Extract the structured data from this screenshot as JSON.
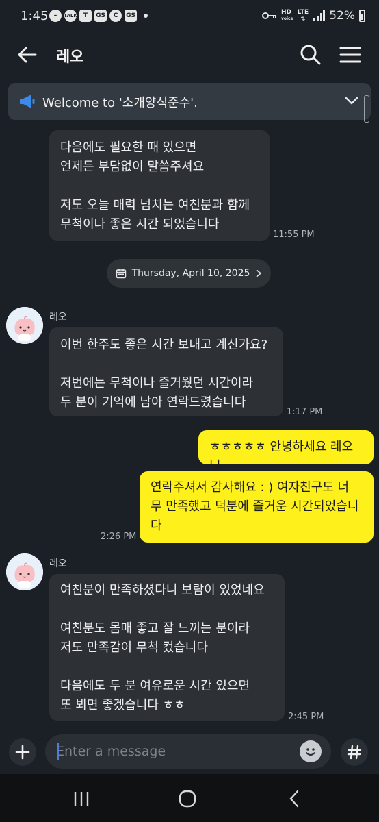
{
  "status_bar": {
    "time": "1:45",
    "icons": [
      "minus-circle-icon",
      "talk-icon",
      "teams-icon",
      "gs-icon",
      "c-icon",
      "gs-icon",
      "dot-icon"
    ],
    "icon_labels": {
      "talk": "TALK",
      "gs": "GS",
      "c": "C"
    },
    "network_hd": "HD",
    "network_voice": "voice",
    "network_lte": "LTE",
    "battery": "52%"
  },
  "header": {
    "title": "레오",
    "icons": [
      "back-arrow-icon",
      "search-icon",
      "hamburger-menu-icon"
    ]
  },
  "notice": {
    "text": "Welcome to '소개양식준수'.",
    "icon": "megaphone-icon",
    "accent": "#3b8beb"
  },
  "messages": [
    {
      "direction": "incoming",
      "text": "다음에도 필요한 때 있으면\n언제든 부담없이 말씀주셔요\n\n저도 오늘 매력 넘치는 여친분과 함께\n무척이나 좋은 시간 되었습니다",
      "time": "11:55 PM"
    },
    {
      "direction": "incoming",
      "sender": "레오",
      "text": "이번 한주도 좋은 시간 보내고 계신가요?\n\n저번에는 무척이나 즐거웠던 시간이라\n두 분이 기억에 남아 연락드렸습니다",
      "time": "1:17 PM"
    },
    {
      "direction": "outgoing",
      "text": "ㅎㅎㅎㅎㅎ 안녕하세요 레오님"
    },
    {
      "direction": "outgoing",
      "text": "연락주셔서 감사해요 : ) 여자친구도 너\n무 만족했고 덕분에 즐거운 시간되었습니\n다",
      "time": "2:26 PM"
    },
    {
      "direction": "incoming",
      "sender": "레오",
      "text": "여친분이 만족하셨다니 보람이 있었네요\n\n여친분도 몸매 좋고 잘 느끼는 분이라\n저도 만족감이 무척 컸습니다\n\n다음에도 두 분 여유로운 시간 있으면\n또 뵈면 좋겠습니다 ㅎㅎ",
      "time": "2:45 PM"
    }
  ],
  "date_divider": {
    "text": "Thursday, April 10, 2025",
    "icon": "calendar-icon"
  },
  "input": {
    "placeholder": "Enter a message",
    "icons": [
      "plus-icon",
      "emoji-icon",
      "hash-icon"
    ]
  },
  "nav": {
    "icons": [
      "recent-apps-icon",
      "home-icon",
      "back-chevron-icon"
    ]
  },
  "colors": {
    "background": "#1b2026",
    "incoming_bubble": "#2d3136",
    "outgoing_bubble": "#fef01b",
    "notice_bg": "#343a41"
  }
}
